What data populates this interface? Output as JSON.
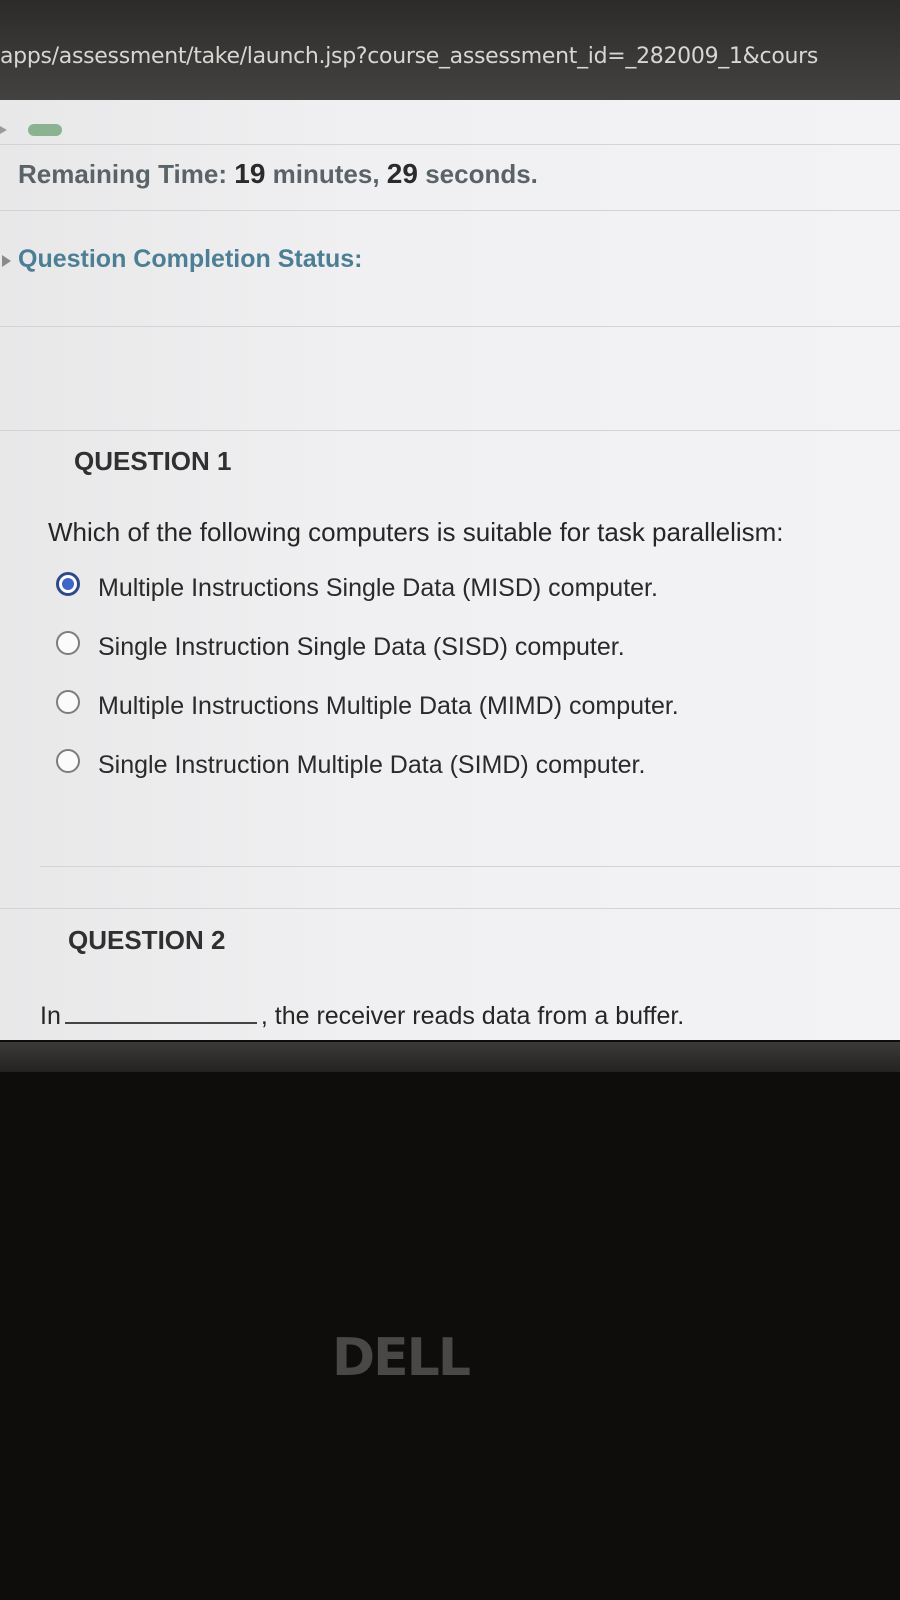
{
  "browser": {
    "url": "apps/assessment/take/launch.jsp?course_assessment_id=_282009_1&cours"
  },
  "header": {
    "remaining_time_label": "Remaining Time:",
    "minutes": "19",
    "minutes_unit": "minutes,",
    "seconds": "29",
    "seconds_unit": "seconds.",
    "completion_status_label": "Question Completion Status:"
  },
  "question1": {
    "title": "QUESTION 1",
    "prompt": "Which of the following computers is suitable for task parallelism:",
    "options": [
      {
        "label": "Multiple Instructions Single Data (MISD) computer.",
        "selected": true
      },
      {
        "label": "Single Instruction Single Data (SISD) computer.",
        "selected": false
      },
      {
        "label": "Multiple Instructions Multiple Data (MIMD) computer.",
        "selected": false
      },
      {
        "label": "Single Instruction Multiple Data (SIMD) computer.",
        "selected": false
      }
    ]
  },
  "question2": {
    "title": "QUESTION 2",
    "prompt_before": "In",
    "prompt_after": ", the receiver reads data from a buffer."
  },
  "device": {
    "logo": "DELL"
  },
  "colors": {
    "accent_selected": "#3f66c9",
    "completion_label": "#4c7f95"
  }
}
